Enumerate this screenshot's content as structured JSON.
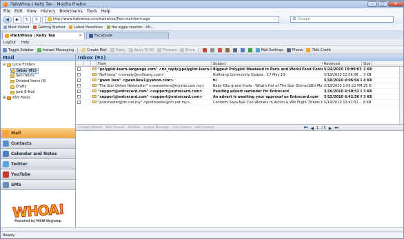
{
  "window": {
    "title": "iTalkWhoa | Kelly Tan - Mozilla Firefox"
  },
  "menu": [
    "File",
    "Edit",
    "View",
    "History",
    "Bookmarks",
    "Tools",
    "Help"
  ],
  "nav": {
    "url": "http://www.italkwhoa.com/italkwhoa/Post.mainform.wgx",
    "search_engine": "G",
    "search_placeholder": "Google"
  },
  "bookmarks": [
    "Most Visited",
    "Getting Started",
    "Latest Headlines",
    "the eggie counter - htt..."
  ],
  "tabs": [
    {
      "label": "iTalkWhoa | Kelly Tan",
      "icon_color": "#f6a21b"
    },
    {
      "label": "Facebook",
      "icon_color": "#3b5998"
    }
  ],
  "appbar": {
    "logout": "LogOut",
    "help": "Help"
  },
  "toolbar": {
    "items": [
      "Toggle Sidebar",
      "Instant Messaging",
      "Create Mail",
      "Reply",
      "Reply To All",
      "Forward",
      "Move",
      "Mail Settings",
      "Phone",
      "iTalk Credit"
    ],
    "disabled": [
      false,
      false,
      false,
      true,
      true,
      true,
      true,
      false,
      false,
      false
    ]
  },
  "sidebar": {
    "mail_header": "Mail",
    "folders": [
      "Local Folders",
      "Inbox (91)",
      "Sent Items",
      "Deleted Items (8)",
      "Drafts",
      "Junk E-Mail",
      "RSS Feeds"
    ],
    "nav": [
      {
        "label": "Mail",
        "color": "#f3a53a"
      },
      {
        "label": "Contacts",
        "color": "#5a8fd0"
      },
      {
        "label": "Calendar and Notes",
        "color": "#4f7fc2"
      },
      {
        "label": "Twitter",
        "color": "#5aa7e0"
      },
      {
        "label": "YouTube",
        "color": "#c43a2c"
      },
      {
        "label": "SMS",
        "color": "#6c8db7"
      }
    ],
    "logo_text": "WHOA!",
    "logo_sub": "Powered by MSW-SkyJump"
  },
  "inbox": {
    "title": "Inbox (91)",
    "columns": [
      "From",
      "Subject",
      "Received",
      "Size"
    ],
    "rows": [
      {
        "from": "\"polyglot-learn-language.com\" <no_reply@polyglot-learn-language.com>",
        "subject": "Biggest Polyglot Weekend in Paris and World Food Contest !!!",
        "received": "5/24/2010 10:09:03 ...",
        "size": "2 KB",
        "bold": true
      },
      {
        "from": "\"Nuffnang\" <noreply@nuffnang.com>",
        "subject": "Nuffnang Community Update - 17 May 10",
        "received": "5/18/2010 11:06:08 ...",
        "size": "3 KB",
        "bold": false
      },
      {
        "from": "\"gwen liew\" <gwenliew1@yahoo.com>",
        "subject": "hi",
        "received": "5/18/2010 4:06:04 P...",
        "size": "4 KB",
        "bold": true
      },
      {
        "from": "\"The Star Online Newsletter\" <newsletters@mystar.com.my>",
        "subject": "Baby Kiko grand finale - What's Hot at The Star Online(18th May, 2010)",
        "received": "5/18/2010 1:09:21 PM",
        "size": "25 KB",
        "bold": false
      },
      {
        "from": "\"support@entrecard.com\" <support@entrecard.com>",
        "subject": "Pending advert reminder for Entrecard",
        "received": "5/16/2010 6:50:52 PM",
        "size": "3 KB",
        "bold": true
      },
      {
        "from": "\"support@entrecard.com\" <support@entrecard.com>",
        "subject": "An advert is awaiting your approval on Entrecard.com",
        "received": "5/15/2010 6:42:56 PM",
        "size": "3 KB",
        "bold": true
      },
      {
        "from": "\"postmaster@tm.net.my\" <postmaster@tm.net.my>",
        "subject": "Contacts Saya Nak Cub Winners In Action & Win Flight Tickets for Yourself!",
        "received": "5/14/2010 10:41:52 ...",
        "size": "8 KB",
        "bold": false
      }
    ]
  },
  "bottombar": {
    "items": [
      "Contact Details",
      "Mail Thread",
      "All Mails",
      "Instant Message",
      "Call Contact",
      "Add Contact"
    ],
    "page": "1",
    "page_of": "/ 5"
  },
  "status": {
    "text": "Ready."
  }
}
